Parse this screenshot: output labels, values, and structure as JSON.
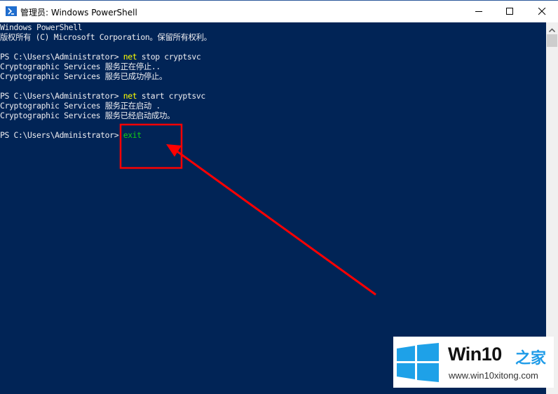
{
  "window": {
    "title": "管理员: Windows PowerShell",
    "controls": {
      "minimize": "minimize",
      "maximize": "maximize",
      "close": "close"
    }
  },
  "console": {
    "colors": {
      "background": "#012456",
      "text": "#eeedf0",
      "command": "#ffff00",
      "typed": "#13d013"
    },
    "lines": [
      {
        "text": "Windows PowerShell"
      },
      {
        "text": "版权所有 (C) Microsoft Corporation。保留所有权利。"
      },
      {
        "text": ""
      },
      {
        "prompt": "PS C:\\Users\\Administrator> ",
        "command": "net",
        "args": " stop cryptsvc"
      },
      {
        "text": "Cryptographic Services 服务正在停止.."
      },
      {
        "text": "Cryptographic Services 服务已成功停止。"
      },
      {
        "text": ""
      },
      {
        "prompt": "PS C:\\Users\\Administrator> ",
        "command": "net",
        "args": " start cryptsvc"
      },
      {
        "text": "Cryptographic Services 服务正在启动 ."
      },
      {
        "text": "Cryptographic Services 服务已经启动成功。"
      },
      {
        "text": ""
      },
      {
        "prompt": "PS C:\\Users\\Administrator> ",
        "typed": "exit"
      }
    ]
  },
  "annotation": {
    "highlight_color": "#ff0000",
    "target": "exit"
  },
  "watermark": {
    "title": "Win10",
    "title_cn": "之家",
    "url": "www.win10xitong.com",
    "accent": "#1e9be8"
  }
}
